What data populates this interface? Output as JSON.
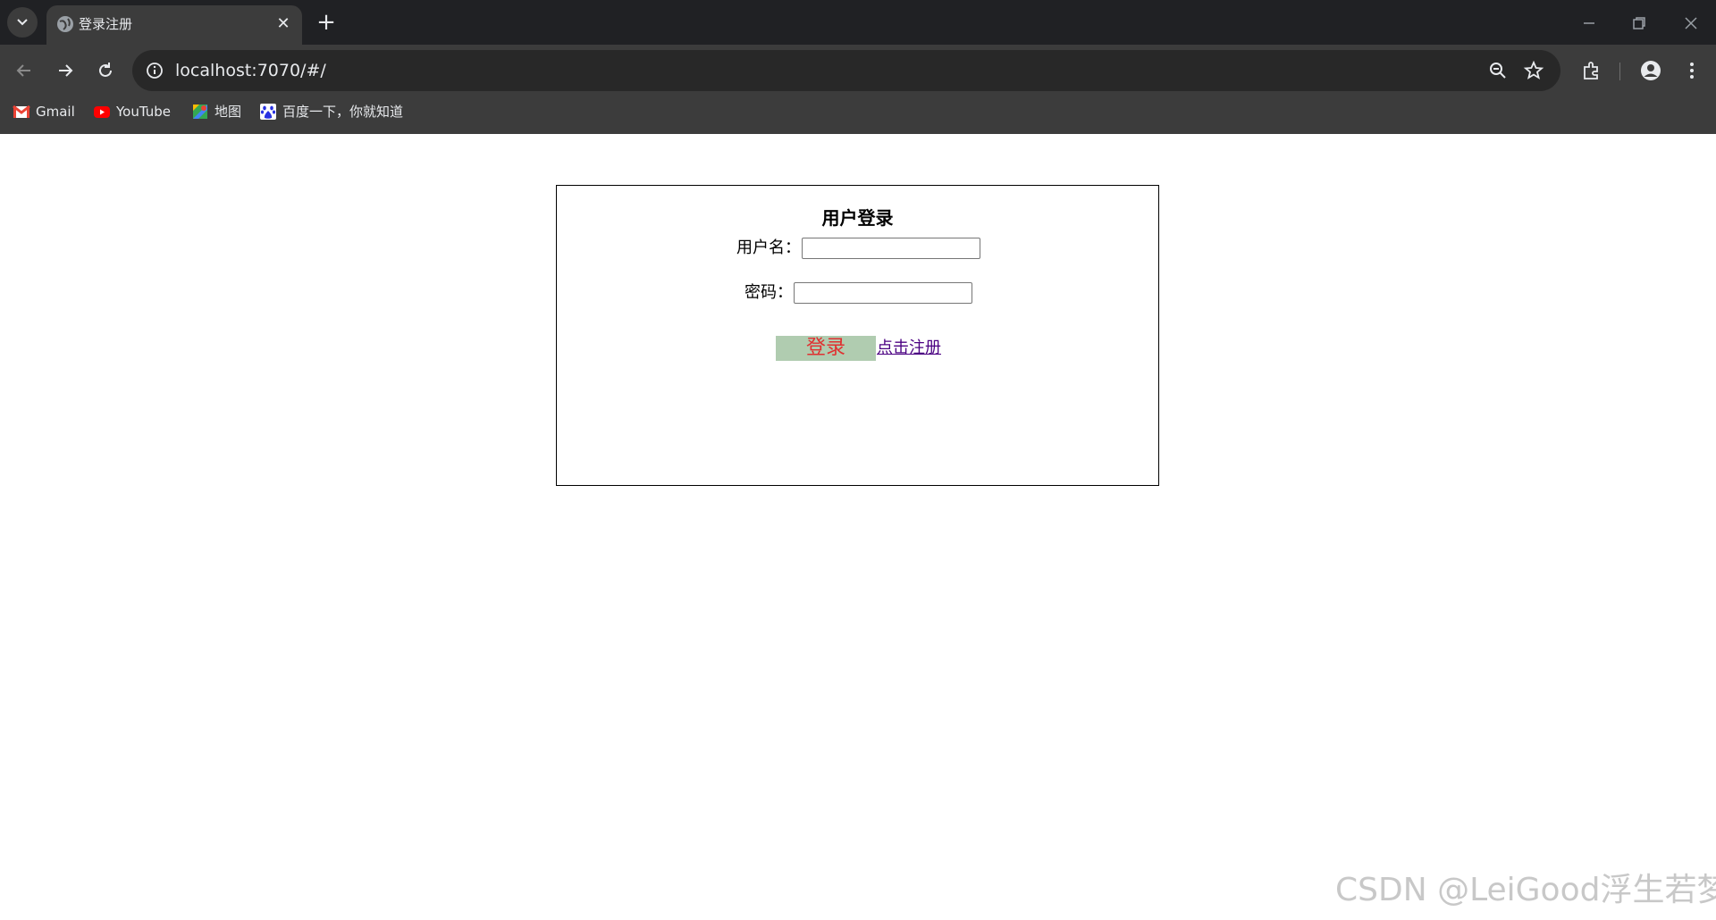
{
  "browser": {
    "tab": {
      "title": "登录注册"
    },
    "address_bar": {
      "url": "localhost:7070/#/"
    },
    "bookmarks": [
      {
        "label": "Gmail",
        "icon": "gmail-icon"
      },
      {
        "label": "YouTube",
        "icon": "youtube-icon"
      },
      {
        "label": "地图",
        "icon": "maps-icon"
      },
      {
        "label": "百度一下，你就知道",
        "icon": "baidu-icon"
      }
    ]
  },
  "login_form": {
    "title": "用户登录",
    "username_label": "用户名：",
    "username_value": "",
    "password_label": "密码：",
    "password_value": "",
    "login_button": "登录",
    "register_link": "点击注册"
  },
  "watermark": "CSDN @LeiGood浮生若梦",
  "colors": {
    "login_button_bg": "#b0ccb0",
    "login_button_text": "#e03030",
    "register_link": "#4b0082"
  }
}
